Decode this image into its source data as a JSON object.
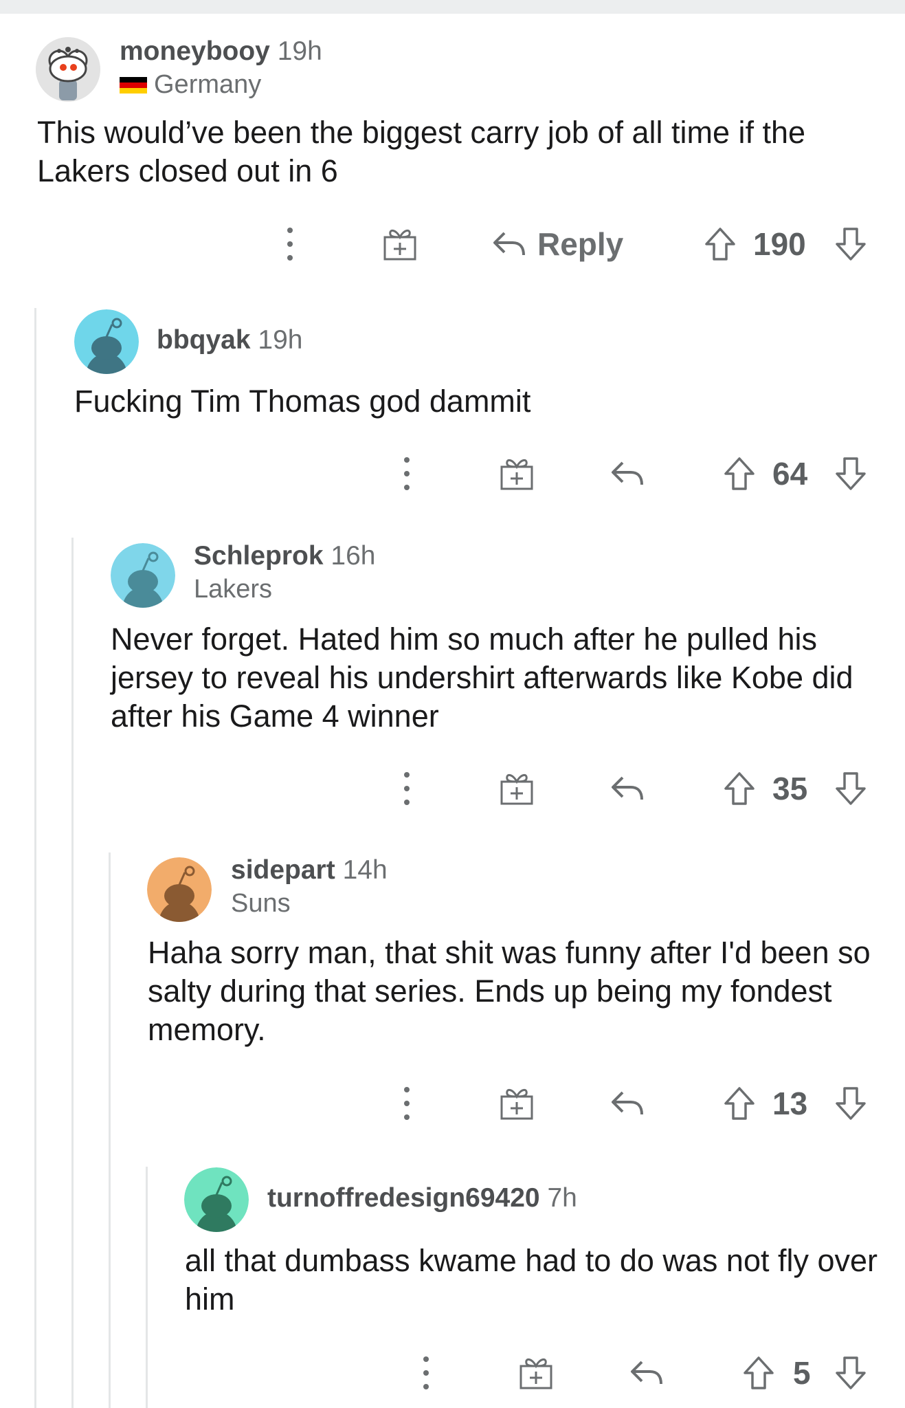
{
  "comments": [
    {
      "username": "moneybooy",
      "time": "19h",
      "flair": "Germany",
      "flair_flag": "germany",
      "avatar_color": "#d8d8d8",
      "body": "This would’ve been the biggest carry job of all time if the Lakers closed out in 6",
      "reply_label": "Reply",
      "score": "190"
    },
    {
      "username": "bbqyak",
      "time": "19h",
      "flair": "",
      "avatar_color": "#6fd6ea",
      "body": "Fucking Tim Thomas god dammit",
      "reply_label": "",
      "score": "64"
    },
    {
      "username": "Schleprok",
      "time": "16h",
      "flair": "Lakers",
      "avatar_color": "#7fd6ea",
      "body": "Never forget. Hated him so much after he pulled his jersey to reveal his undershirt afterwards like Kobe did after his Game 4 winner",
      "reply_label": "",
      "score": "35"
    },
    {
      "username": "sidepart",
      "time": "14h",
      "flair": "Suns",
      "avatar_color": "#f2ac6b",
      "body": "Haha sorry man, that shit was funny after I'd been so salty during that series.  Ends up being my fondest memory.",
      "reply_label": "",
      "score": "13"
    },
    {
      "username": "turnoffredesign69420",
      "time": "7h",
      "flair": "",
      "avatar_color": "#6fe3bf",
      "body": "all that dumbass kwame had to do was not fly over him",
      "reply_label": "",
      "score": "5"
    }
  ]
}
